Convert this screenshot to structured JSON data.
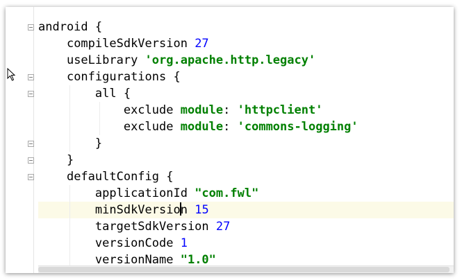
{
  "editor": {
    "lines": [
      {
        "indent": 0,
        "parts": [
          {
            "t": "android {",
            "c": "plain"
          }
        ]
      },
      {
        "indent": 1,
        "parts": [
          {
            "t": "compileSdkVersion ",
            "c": "plain"
          },
          {
            "t": "27",
            "c": "num"
          }
        ]
      },
      {
        "indent": 1,
        "parts": [
          {
            "t": "useLibrary ",
            "c": "plain"
          },
          {
            "t": "'org.apache.http.legacy'",
            "c": "str"
          }
        ]
      },
      {
        "indent": 1,
        "parts": [
          {
            "t": "configurations {",
            "c": "plain"
          }
        ]
      },
      {
        "indent": 2,
        "parts": [
          {
            "t": "all {",
            "c": "plain"
          }
        ]
      },
      {
        "indent": 3,
        "parts": [
          {
            "t": "exclude ",
            "c": "plain"
          },
          {
            "t": "module",
            "c": "kw"
          },
          {
            "t": ": ",
            "c": "plain"
          },
          {
            "t": "'httpclient'",
            "c": "str"
          }
        ]
      },
      {
        "indent": 3,
        "parts": [
          {
            "t": "exclude ",
            "c": "plain"
          },
          {
            "t": "module",
            "c": "kw"
          },
          {
            "t": ": ",
            "c": "plain"
          },
          {
            "t": "'commons-logging'",
            "c": "str"
          }
        ]
      },
      {
        "indent": 2,
        "parts": [
          {
            "t": "}",
            "c": "plain"
          }
        ]
      },
      {
        "indent": 1,
        "parts": [
          {
            "t": "}",
            "c": "plain"
          }
        ]
      },
      {
        "indent": 1,
        "parts": [
          {
            "t": "defaultConfig {",
            "c": "plain"
          }
        ]
      },
      {
        "indent": 2,
        "parts": [
          {
            "t": "applicationId ",
            "c": "plain"
          },
          {
            "t": "\"com.fwl\"",
            "c": "str"
          }
        ]
      },
      {
        "indent": 2,
        "current": true,
        "parts": [
          {
            "t": "minSdkVersio",
            "c": "plain"
          },
          {
            "t": "|",
            "c": "caret"
          },
          {
            "t": "n ",
            "c": "plain"
          },
          {
            "t": "15",
            "c": "num"
          }
        ]
      },
      {
        "indent": 2,
        "parts": [
          {
            "t": "targetSdkVersion ",
            "c": "plain"
          },
          {
            "t": "27",
            "c": "num"
          }
        ]
      },
      {
        "indent": 2,
        "parts": [
          {
            "t": "versionCode ",
            "c": "plain"
          },
          {
            "t": "1",
            "c": "num"
          }
        ]
      },
      {
        "indent": 2,
        "parts": [
          {
            "t": "versionName ",
            "c": "plain"
          },
          {
            "t": "\"1.0\"",
            "c": "str"
          }
        ]
      }
    ],
    "folds": [
      {
        "line": 0,
        "kind": "open"
      },
      {
        "line": 3,
        "kind": "open"
      },
      {
        "line": 4,
        "kind": "open"
      },
      {
        "line": 7,
        "kind": "close"
      },
      {
        "line": 8,
        "kind": "close"
      },
      {
        "line": 9,
        "kind": "open"
      }
    ],
    "colors": {
      "keyword": "#008000",
      "number": "#0000ff",
      "string": "#008000",
      "current_line": "#fcfae7"
    }
  },
  "icons": {
    "mouse_pointer": "arrow-cursor-icon",
    "fold_marker": "fold-marker-icon"
  }
}
